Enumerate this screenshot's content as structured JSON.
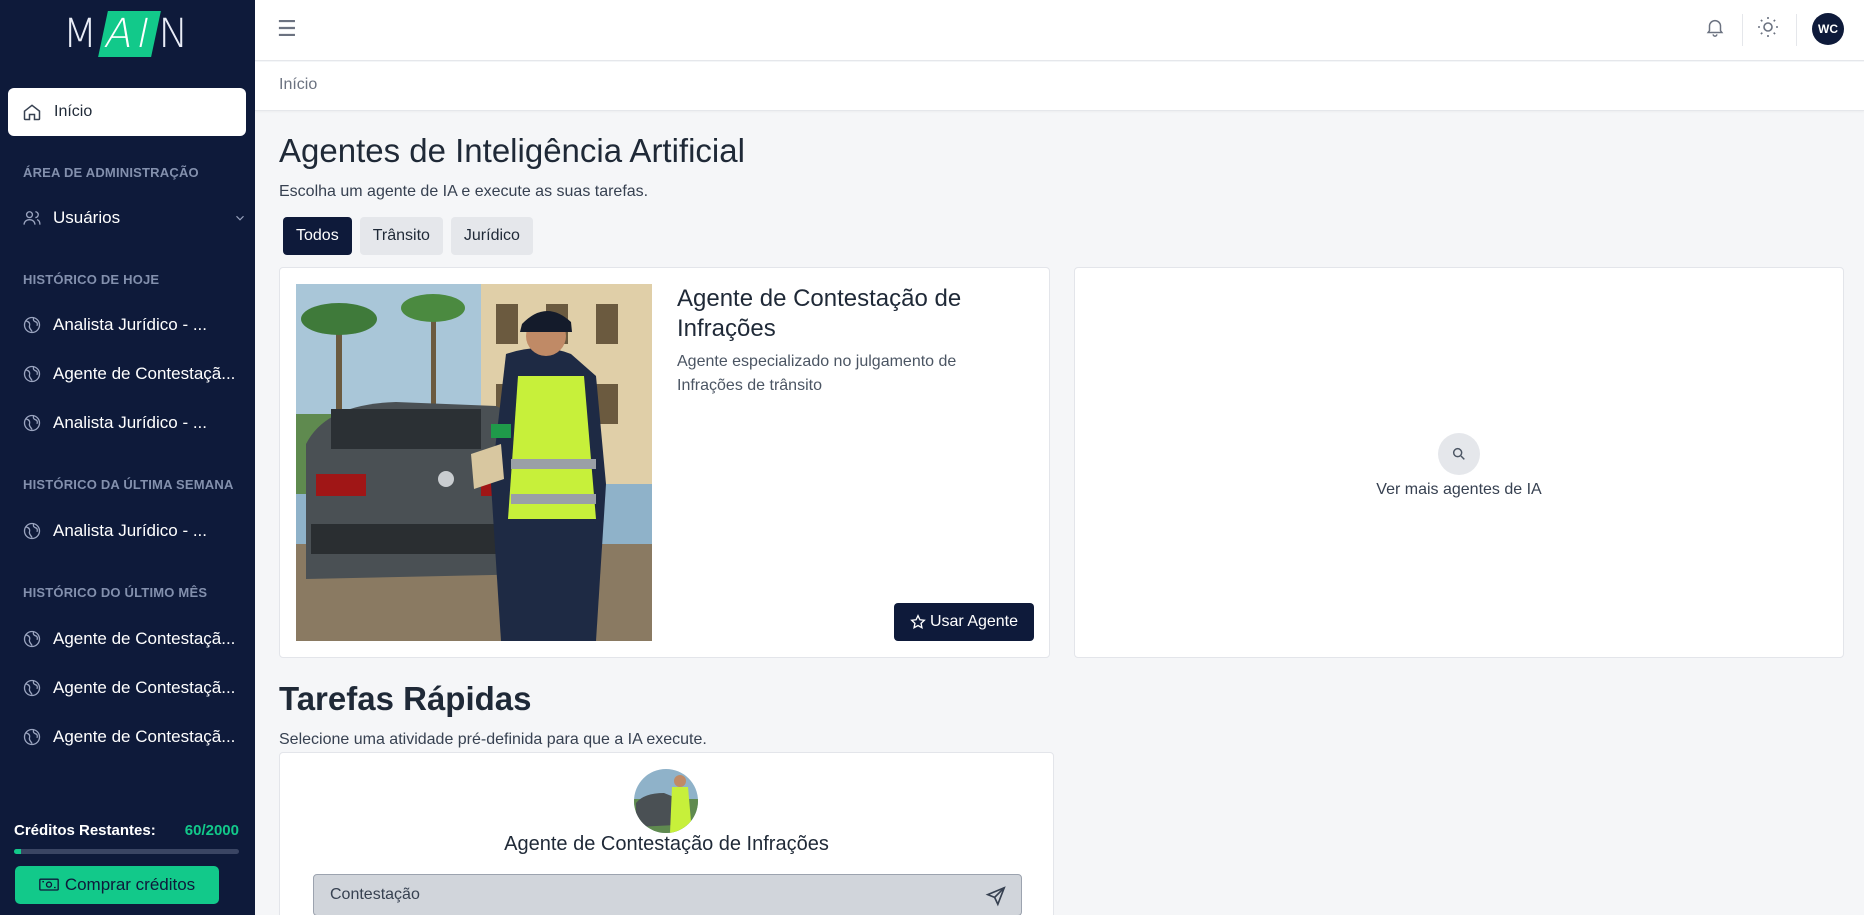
{
  "app": {
    "logo_text_left": "M",
    "logo_text_accent": "AI",
    "logo_text_right": "N"
  },
  "sidebar": {
    "home_label": "Início",
    "admin_section": "ÁREA DE ADMINISTRAÇÃO",
    "users_label": "Usuários",
    "today_section": "HISTÓRICO DE HOJE",
    "today_items": [
      "Analista Jurídico - ...",
      "Agente de Contestaçã...",
      "Analista Jurídico - ..."
    ],
    "week_section": "HISTÓRICO DA ÚLTIMA SEMANA",
    "week_items": [
      "Analista Jurídico - ..."
    ],
    "month_section": "HISTÓRICO DO ÚLTIMO MÊS",
    "month_items": [
      "Agente de Contestaçã...",
      "Agente de Contestaçã...",
      "Agente de Contestaçã..."
    ],
    "credits_label": "Créditos Restantes:",
    "credits_value": "60/2000",
    "credits_fraction": 0.03,
    "buy_label": "Comprar créditos"
  },
  "topbar": {
    "avatar_initials": "WC"
  },
  "breadcrumb": "Início",
  "main": {
    "title": "Agentes de Inteligência Artificial",
    "subtitle": "Escolha um agente de IA e execute as suas tarefas.",
    "filters": [
      "Todos",
      "Trânsito",
      "Jurídico"
    ],
    "agent": {
      "title": "Agente de Contestação de Infrações",
      "description": "Agente especializado no julgamento de Infrações de trânsito",
      "button": "Usar Agente"
    },
    "more_agents": "Ver mais agentes de IA",
    "tasks_title": "Tarefas Rápidas",
    "tasks_subtitle": "Selecione uma atividade pré-definida para que a IA execute.",
    "task": {
      "agent_name": "Agente de Contestação de Infrações",
      "input_value": "Contestação"
    }
  },
  "colors": {
    "navy": "#0e1a3a",
    "accent": "#12c98a"
  }
}
